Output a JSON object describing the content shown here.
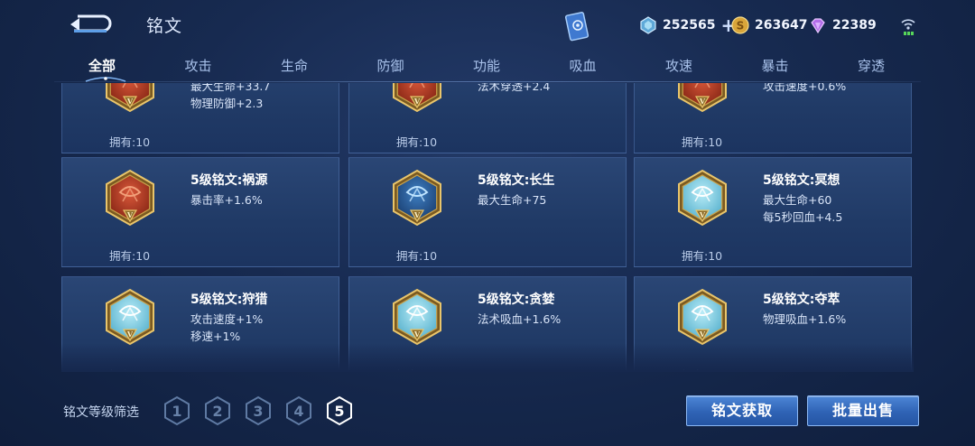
{
  "header": {
    "title": "铭文",
    "currencies": [
      {
        "name": "diamond-crystal",
        "value": "252565"
      },
      {
        "name": "gold-coin",
        "value": "263647"
      },
      {
        "name": "purple-gem",
        "value": "22389"
      }
    ]
  },
  "tabs": [
    {
      "label": "全部",
      "active": true
    },
    {
      "label": "攻击"
    },
    {
      "label": "生命"
    },
    {
      "label": "防御"
    },
    {
      "label": "功能"
    },
    {
      "label": "吸血"
    },
    {
      "label": "攻速"
    },
    {
      "label": "暴击"
    },
    {
      "label": "穿透"
    }
  ],
  "cards": [
    {
      "name": "",
      "stats": [
        "最大生命+33.7",
        "物理防御+2.3"
      ],
      "owned": "拥有:10",
      "theme": "red"
    },
    {
      "name": "",
      "stats": [
        "法术穿透+2.4"
      ],
      "owned": "拥有:10",
      "theme": "red"
    },
    {
      "name": "",
      "stats": [
        "攻击速度+0.6%"
      ],
      "owned": "拥有:10",
      "theme": "red"
    },
    {
      "name": "5级铭文:祸源",
      "stats": [
        "暴击率+1.6%"
      ],
      "owned": "拥有:10",
      "theme": "red"
    },
    {
      "name": "5级铭文:长生",
      "stats": [
        "最大生命+75"
      ],
      "owned": "拥有:10",
      "theme": "blue"
    },
    {
      "name": "5级铭文:冥想",
      "stats": [
        "最大生命+60",
        "每5秒回血+4.5"
      ],
      "owned": "拥有:10",
      "theme": "cyan"
    },
    {
      "name": "5级铭文:狩猎",
      "stats": [
        "攻击速度+1%",
        "移速+1%"
      ],
      "owned": "拥有:10",
      "theme": "cyan"
    },
    {
      "name": "5级铭文:贪婪",
      "stats": [
        "法术吸血+1.6%"
      ],
      "owned": "拥有:10",
      "theme": "cyan"
    },
    {
      "name": "5级铭文:夺萃",
      "stats": [
        "物理吸血+1.6%"
      ],
      "owned": "拥有:10",
      "theme": "cyan"
    }
  ],
  "filter": {
    "label": "铭文等级筛选",
    "levels": [
      "1",
      "2",
      "3",
      "4",
      "5"
    ],
    "selected": "5"
  },
  "buttons": {
    "acquire": "铭文获取",
    "bulk_sell": "批量出售"
  },
  "badge_mark": "V",
  "colors": {
    "background": "#172a50",
    "card": "#24406e",
    "gold": "#c9a24a",
    "red_badge": "#c0452a",
    "blue_badge": "#2c5f99",
    "cyan_badge": "#8fd3e6",
    "button": "#3a6fc2"
  }
}
